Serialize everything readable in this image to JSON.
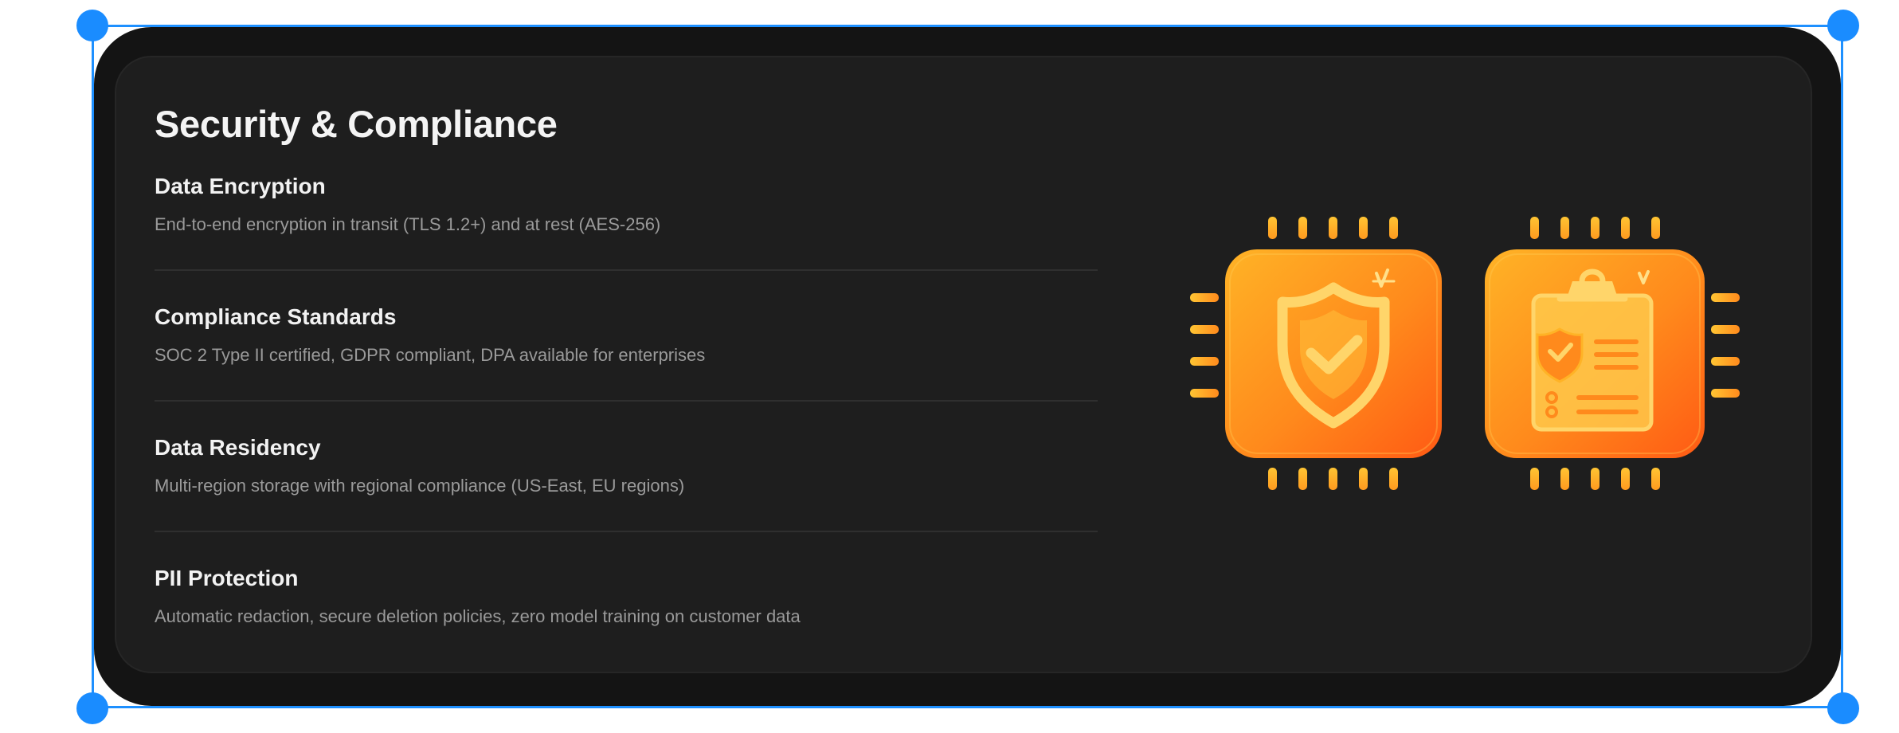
{
  "section": {
    "title": "Security & Compliance"
  },
  "features": [
    {
      "title": "Data Encryption",
      "description": "End-to-end encryption in transit (TLS 1.2+) and at rest (AES-256)"
    },
    {
      "title": "Compliance Standards",
      "description": "SOC 2 Type II certified, GDPR compliant, DPA available for enterprises"
    },
    {
      "title": "Data Residency",
      "description": "Multi-region storage with regional compliance (US-East, EU regions)"
    },
    {
      "title": "PII Protection",
      "description": "Automatic redaction, secure deletion policies, zero model training on customer data"
    }
  ],
  "illustration": {
    "icons": [
      "shield-check-chip-icon",
      "clipboard-shield-chip-icon"
    ],
    "colors": {
      "chip_top": "#ffb326",
      "chip_bottom": "#ff5a14",
      "pin": "#ffb526",
      "symbol": "#ffd56a"
    }
  },
  "theme": {
    "outer_background": "#141414",
    "card_background": "#1e1e1e",
    "selection_color": "#1a8cff"
  }
}
